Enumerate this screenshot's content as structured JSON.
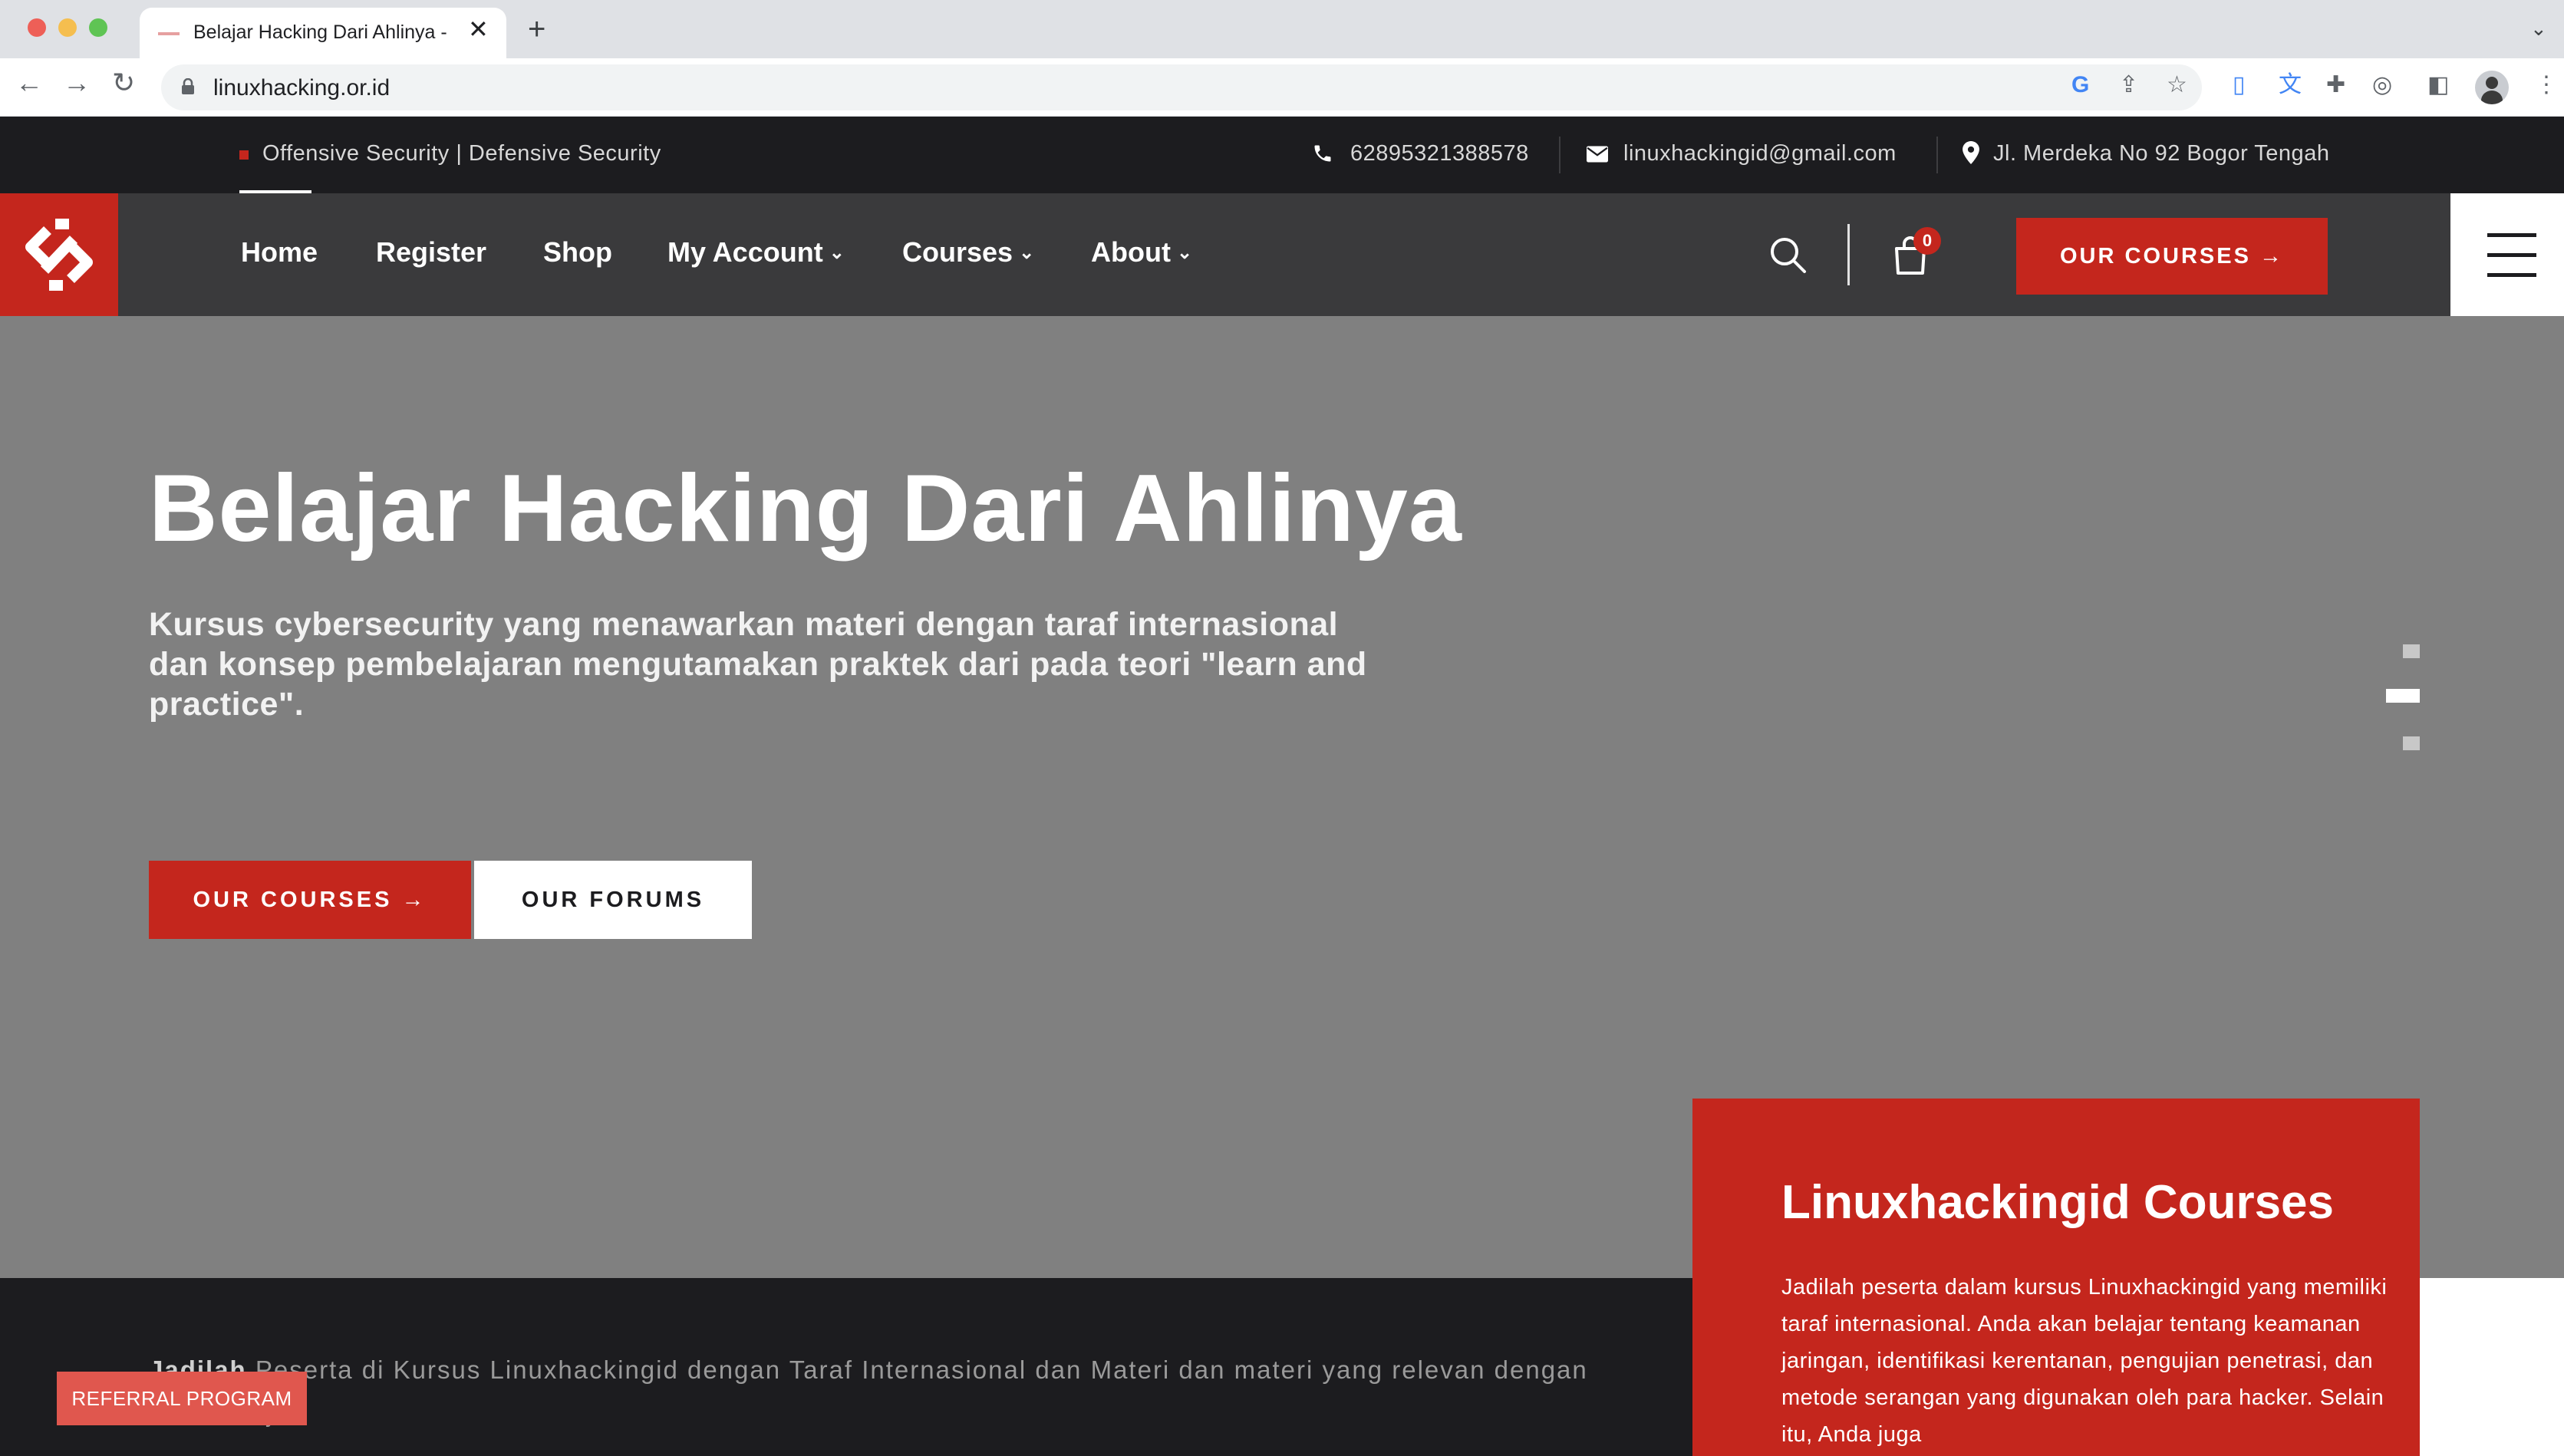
{
  "browser": {
    "tab_title": "Belajar Hacking Dari Ahlinya - Linuxhackingid",
    "url": "linuxhacking.or.id",
    "icons": [
      "back-icon",
      "forward-icon",
      "reload-icon",
      "lock-icon",
      "google-icon",
      "share-icon",
      "star-icon",
      "extension-icon",
      "translate-icon",
      "puzzle-icon",
      "sidepanel-icon",
      "profile-icon",
      "more-icon"
    ]
  },
  "topbar": {
    "tagline": "Offensive Security | Defensive Security",
    "phone": "62895321388578",
    "email": "linuxhackingid@gmail.com",
    "address": "Jl. Merdeka No 92 Bogor Tengah"
  },
  "nav": {
    "items": [
      {
        "label": "Home"
      },
      {
        "label": "Register"
      },
      {
        "label": "Shop"
      },
      {
        "label": "My Account"
      },
      {
        "label": "Courses"
      },
      {
        "label": "About"
      }
    ],
    "cart_count": "0",
    "cta": "OUR COURSES →"
  },
  "hero": {
    "title": "Belajar Hacking Dari Ahlinya",
    "subtitle": "Kursus cybersecurity yang menawarkan materi dengan taraf internasional dan konsep pembelajaran mengutamakan praktek dari pada teori \"learn and practice\".",
    "btn_primary": "OUR COURSES →",
    "btn_secondary": "OUR FORUMS",
    "slider_active_index": 1
  },
  "band": {
    "lead": "Jadilah",
    "text": " Peserta di Kursus Linuxhackingid dengan Taraf Internasional dan Materi dan materi yang relevan dengan dunia kerja"
  },
  "card": {
    "title": "Linuxhackingid Courses",
    "text": "Jadilah peserta dalam kursus Linuxhackingid yang memiliki taraf internasional. Anda akan belajar tentang keamanan jaringan, identifikasi kerentanan, pengujian penetrasi, dan metode serangan yang digunakan oleh para hacker. Selain itu, Anda juga"
  },
  "referral": "REFERRAL PROGRAM",
  "colors": {
    "brand_red": "#c4261d",
    "dark": "#1c1c1f",
    "nav_bg": "#3a3a3c",
    "hero_bg": "#808080"
  }
}
